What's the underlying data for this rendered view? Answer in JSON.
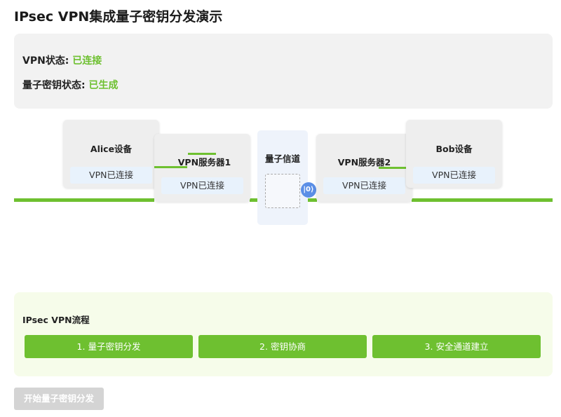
{
  "page": {
    "title": "IPsec VPN集成量子密钥分发演示"
  },
  "status": {
    "vpn_label": "VPN状态:",
    "vpn_value": "已连接",
    "key_label": "量子密钥状态:",
    "key_value": "已生成"
  },
  "network": {
    "alice": {
      "name": "Alice设备",
      "status": "VPN已连接"
    },
    "server1": {
      "name": "VPN服务器1",
      "status": "VPN已连接"
    },
    "channel": {
      "name": "量子信道"
    },
    "photon": {
      "symbol": "|0⟩"
    },
    "server2": {
      "name": "VPN服务器2",
      "status": "VPN已连接"
    },
    "bob": {
      "name": "Bob设备",
      "status": "VPN已连接"
    }
  },
  "flow": {
    "title": "IPsec VPN流程",
    "steps": [
      "1. 量子密钥分发",
      "2. 密钥协商",
      "3. 安全通道建立"
    ]
  },
  "actions": {
    "start_label": "开始量子密钥分发"
  },
  "colors": {
    "accent_green": "#6ec030",
    "status_badge_bg": "#e8f2fc",
    "photon_blue": "#5a8ee6",
    "disabled_button": "#d4d4d4"
  }
}
